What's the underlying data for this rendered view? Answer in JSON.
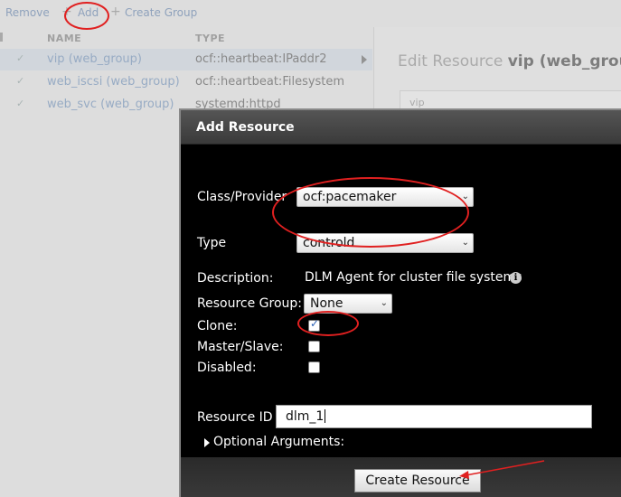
{
  "toolbar": {
    "remove_label": "Remove",
    "add_label": "Add",
    "create_group_label": "Create Group"
  },
  "table": {
    "columns": [
      "NAME",
      "TYPE"
    ],
    "rows": [
      {
        "name": "vip (web_group)",
        "type": "ocf::heartbeat:IPaddr2"
      },
      {
        "name": "web_iscsi (web_group)",
        "type": "ocf::heartbeat:Filesystem"
      },
      {
        "name": "web_svc (web_group)",
        "type": "systemd:httpd"
      }
    ]
  },
  "edit_panel": {
    "title_prefix": "Edit Resource",
    "title_name": "vip (web_group",
    "field_value": "vip"
  },
  "dialog": {
    "title": "Add Resource",
    "class_provider_label": "Class/Provider",
    "class_provider_value": "ocf:pacemaker",
    "type_label": "Type",
    "type_value": "controld",
    "description_label": "Description:",
    "description_value": "DLM Agent for cluster file systems",
    "resource_group_label": "Resource Group:",
    "resource_group_value": "None",
    "clone_label": "Clone:",
    "clone_checked": true,
    "master_slave_label": "Master/Slave:",
    "master_slave_checked": false,
    "disabled_label": "Disabled:",
    "disabled_checked": false,
    "resource_id_label": "Resource ID",
    "resource_id_value": "dlm_1",
    "optional_arguments_label": "Optional Arguments:",
    "create_button_label": "Create Resource"
  },
  "colors": {
    "annotation": "#e02020",
    "link": "#6f8db5",
    "dialog_bg": "#000000"
  },
  "icons": [
    "check-icon",
    "chevron-right-icon",
    "info-icon",
    "dropdown-caret-icon",
    "disclosure-triangle-icon"
  ]
}
